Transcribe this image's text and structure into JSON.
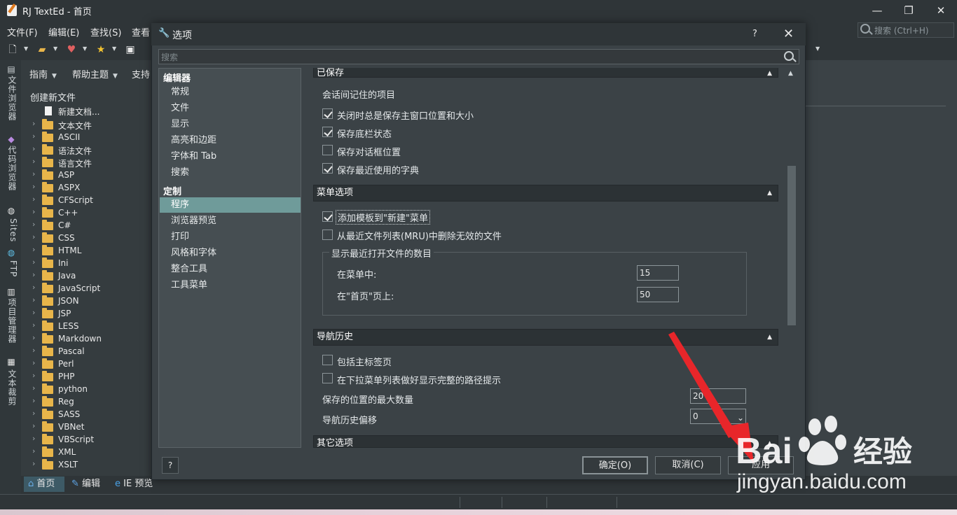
{
  "app": {
    "title": "RJ TextEd - 首页",
    "window_controls": [
      "—",
      "❐",
      "✕"
    ]
  },
  "menu": {
    "items": [
      "文件(F)",
      "编辑(E)",
      "查找(S)",
      "查看"
    ],
    "search_placeholder": "搜索 (Ctrl+H)"
  },
  "side_tabs": [
    "文件浏览器",
    "代码浏览器",
    "Sites",
    "FTP",
    "项目管理器",
    "文本裁剪"
  ],
  "left_panel": {
    "nav": [
      "指南",
      "帮助主题",
      "支持"
    ],
    "title": "创建新文件",
    "new_doc": "新建文档...",
    "tree": [
      "文本文件",
      "ASCII",
      "语法文件",
      "语言文件",
      "ASP",
      "ASPX",
      "CFScript",
      "C++",
      "C#",
      "CSS",
      "HTML",
      "Ini",
      "Java",
      "JavaScript",
      "JSON",
      "JSP",
      "LESS",
      "Markdown",
      "Pascal",
      "Perl",
      "PHP",
      "python",
      "Reg",
      "SASS",
      "VBNet",
      "VBScript",
      "XML",
      "XSLT"
    ]
  },
  "doc_tabs": [
    "首页",
    "编辑",
    "IE 预览"
  ],
  "dialog": {
    "title": "选项",
    "help": "?",
    "close": "✕",
    "search_placeholder": "搜索",
    "categories": {
      "group1": "编辑器",
      "group1_items": [
        "常规",
        "文件",
        "显示",
        "高亮和边距",
        "字体和 Tab",
        "搜索"
      ],
      "group2": "定制",
      "group2_items": [
        "程序",
        "浏览器预览",
        "打印",
        "风格和字体",
        "整合工具",
        "工具菜单"
      ],
      "selected": "程序"
    },
    "sections": {
      "saved": {
        "header": "已保存",
        "subtitle": "会话间记住的项目",
        "options": [
          {
            "label": "关闭时总是保存主窗口位置和大小",
            "checked": true
          },
          {
            "label": "保存底栏状态",
            "checked": true
          },
          {
            "label": "保存对话框位置",
            "checked": false
          },
          {
            "label": "保存最近使用的字典",
            "checked": true
          }
        ]
      },
      "menu": {
        "header": "菜单选项",
        "options": [
          {
            "label": "添加模板到\"新建\"菜单",
            "checked": true
          },
          {
            "label": "从最近文件列表(MRU)中删除无效的文件",
            "checked": false
          }
        ],
        "group_title": "显示最近打开文件的数目",
        "in_menu_label": "在菜单中:",
        "in_menu_value": "15",
        "in_home_label": "在\"首页\"页上:",
        "in_home_value": "50"
      },
      "nav": {
        "header": "导航历史",
        "options": [
          {
            "label": "包括主标签页",
            "checked": false
          },
          {
            "label": "在下拉菜单列表做好显示完整的路径提示",
            "checked": false
          }
        ],
        "max_label": "保存的位置的最大数量",
        "max_value": "20",
        "offset_label": "导航历史偏移",
        "offset_value": "0"
      },
      "other": {
        "header": "其它选项"
      }
    },
    "footer": {
      "help": "?",
      "ok": "确定(O)",
      "cancel": "取消(C)",
      "apply": "应用"
    }
  },
  "watermark": {
    "brand": "Bai",
    "brand_cn": "经验",
    "url": "jingyan.baidu.com"
  },
  "colors": {
    "accent_selected": "#6f9b9a",
    "arrow": "#e8262a"
  }
}
